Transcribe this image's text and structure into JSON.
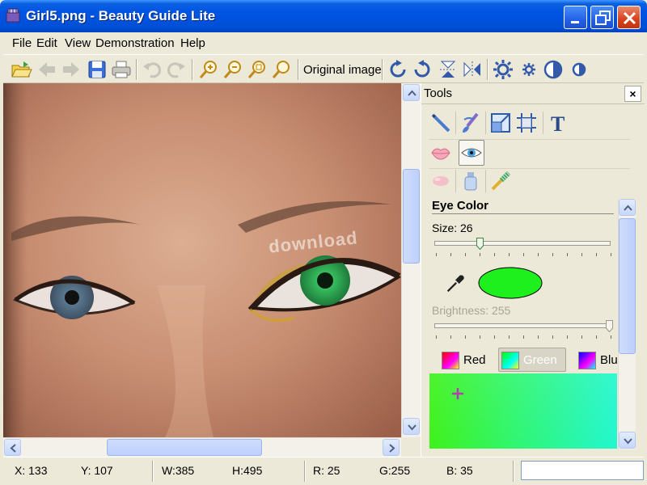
{
  "window": {
    "title": "Girl5.png - Beauty Guide Lite",
    "title_color": "#0054e3"
  },
  "menu": [
    "File",
    "Edit",
    "View",
    "Demonstration",
    "Help"
  ],
  "toolbar": {
    "buttons": [
      "open-icon",
      "back-arrow-icon",
      "forward-arrow-icon",
      "save-icon",
      "print-icon",
      "undo-icon",
      "redo-icon",
      "zoom-in-icon",
      "zoom-out-icon",
      "zoom-fit-icon",
      "zoom-actual-icon",
      "rotate-cw-icon",
      "rotate-ccw-icon",
      "flip-vertical-icon",
      "flip-horizontal-icon",
      "brightness-icon",
      "brightness-small-icon",
      "contrast-icon",
      "contrast-small-icon"
    ],
    "original_image_label": "Original image"
  },
  "canvas": {
    "watermark": "download"
  },
  "tools": {
    "title": "Tools",
    "close_label": "×",
    "row1": [
      "pencil-icon",
      "retouch-brush-icon",
      "resize-icon",
      "crop-icon",
      "text-icon"
    ],
    "row1_text_glyph": "T",
    "row2": [
      "lips-icon",
      "eye-icon"
    ],
    "row3": [
      "blush-icon",
      "foundation-bottle-icon",
      "mascara-brush-icon"
    ],
    "active_tool": "eye-icon",
    "section": {
      "title": "Eye Color",
      "size_label": "Size:",
      "size_value": "26",
      "brightness_label": "Brightness:",
      "brightness_value": "255",
      "selected_color": "#1ef01e",
      "tabs": [
        {
          "label": "Red",
          "active": false
        },
        {
          "label": "Green",
          "active": true
        },
        {
          "label": "Blu",
          "active": false
        }
      ]
    }
  },
  "status": {
    "x_label": "X:",
    "x": "133",
    "y_label": "Y:",
    "y": "107",
    "w_label": "W:",
    "w": "385",
    "h_label": "H:",
    "h": "495",
    "r_label": "R:",
    "r": "25",
    "g_label": "G:",
    "g": "255",
    "b_label": "B:",
    "b": "35"
  }
}
